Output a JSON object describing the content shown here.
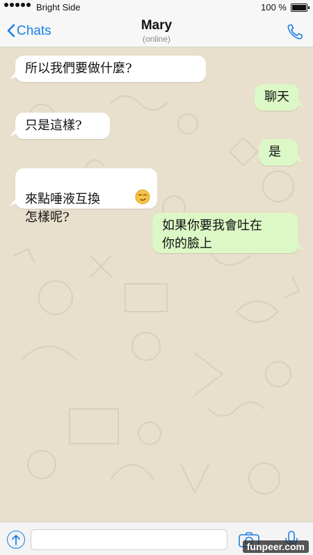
{
  "status_bar": {
    "carrier": "Bright Side",
    "battery": "100 %"
  },
  "header": {
    "back_label": "Chats",
    "contact_name": "Mary",
    "contact_status": "(online)"
  },
  "messages": [
    {
      "direction": "in",
      "text": "所以我們要做什麼?"
    },
    {
      "direction": "out",
      "text": "聊天"
    },
    {
      "direction": "in",
      "text": "只是這樣?"
    },
    {
      "direction": "out",
      "text": "是"
    },
    {
      "direction": "in",
      "text": "來點唾液互換\n怎樣呢?",
      "emoji": "smirk-emoji"
    },
    {
      "direction": "out",
      "text": "如果你要我會吐在\n你的臉上"
    }
  ],
  "composer": {
    "value": ""
  },
  "watermark": "funpeer.com",
  "colors": {
    "accent": "#1a7ee6",
    "incoming_bubble": "#ffffff",
    "outgoing_bubble": "#dcf8c6",
    "chat_background": "#e8dfcc"
  }
}
